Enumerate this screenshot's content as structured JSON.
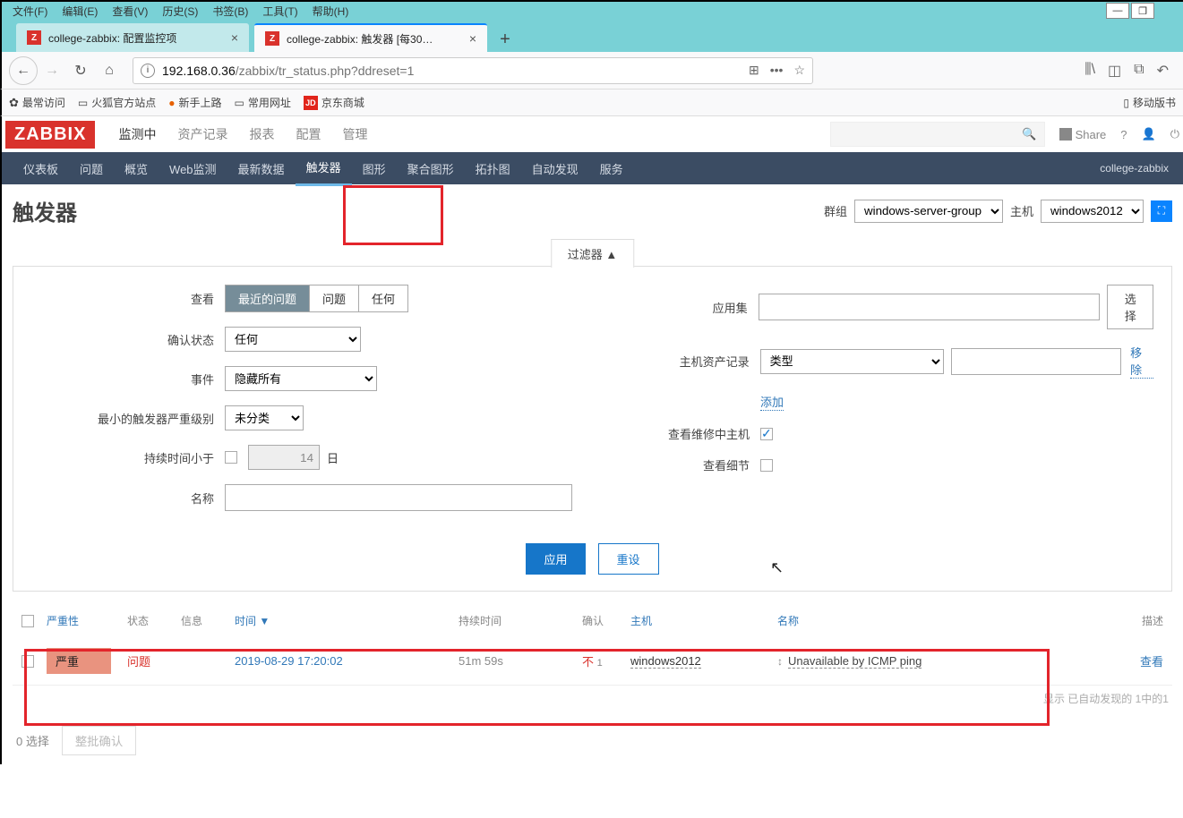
{
  "browser": {
    "menus": [
      "文件(F)",
      "编辑(E)",
      "查看(V)",
      "历史(S)",
      "书签(B)",
      "工具(T)",
      "帮助(H)"
    ],
    "tabs": [
      {
        "title": "college-zabbix: 配置监控项",
        "active": false
      },
      {
        "title": "college-zabbix: 触发器 [每30…",
        "active": true
      }
    ],
    "url_host": "192.168.0.36",
    "url_path": "/zabbix/tr_status.php?ddreset=1",
    "bookmarks": {
      "frequent": "最常访问",
      "firefox_site": "火狐官方站点",
      "getting_started": "新手上路",
      "common_sites": "常用网址",
      "jd": "京东商城",
      "mobile": "移动版书"
    }
  },
  "zabbix": {
    "logo": "ZABBIX",
    "main_menu": [
      "监测中",
      "资产记录",
      "报表",
      "配置",
      "管理"
    ],
    "main_active_index": 0,
    "share": "Share",
    "sub_menu": [
      "仪表板",
      "问题",
      "概览",
      "Web监测",
      "最新数据",
      "触发器",
      "图形",
      "聚合图形",
      "拓扑图",
      "自动发现",
      "服务"
    ],
    "sub_active_index": 5,
    "breadcrumb": "college-zabbix"
  },
  "page": {
    "title": "触发器",
    "group_label": "群组",
    "group_value": "windows-server-group",
    "host_label": "主机",
    "host_value": "windows2012"
  },
  "filter": {
    "tab_label": "过滤器 ▲",
    "view_label": "查看",
    "view_opts": [
      "最近的问题",
      "问题",
      "任何"
    ],
    "ack_label": "确认状态",
    "ack_value": "任何",
    "events_label": "事件",
    "events_value": "隐藏所有",
    "min_sev_label": "最小的触发器严重级别",
    "min_sev_value": "未分类",
    "duration_label": "持续时间小于",
    "duration_value": "14",
    "duration_unit": "日",
    "name_label": "名称",
    "appset_label": "应用集",
    "appset_btn": "选择",
    "inventory_label": "主机资产记录",
    "inventory_value": "类型",
    "inventory_remove": "移除",
    "inventory_add": "添加",
    "maintenance_label": "查看维修中主机",
    "details_label": "查看细节",
    "apply": "应用",
    "reset": "重设"
  },
  "table": {
    "headers": {
      "severity": "严重性",
      "status": "状态",
      "info": "信息",
      "time": "时间 ▼",
      "duration": "持续时间",
      "ack": "确认",
      "host": "主机",
      "name": "名称",
      "desc": "描述"
    },
    "rows": [
      {
        "severity": "严重",
        "status": "问题",
        "time": "2019-08-29 17:20:02",
        "duration": "51m 59s",
        "ack": "不",
        "ack_count": "1",
        "host": "windows2012",
        "name": "Unavailable by ICMP ping",
        "desc_link": "查看"
      }
    ],
    "footer": "显示 已自动发现的 1中的1",
    "selected": "0 选择",
    "batch_ack": "整批确认"
  }
}
